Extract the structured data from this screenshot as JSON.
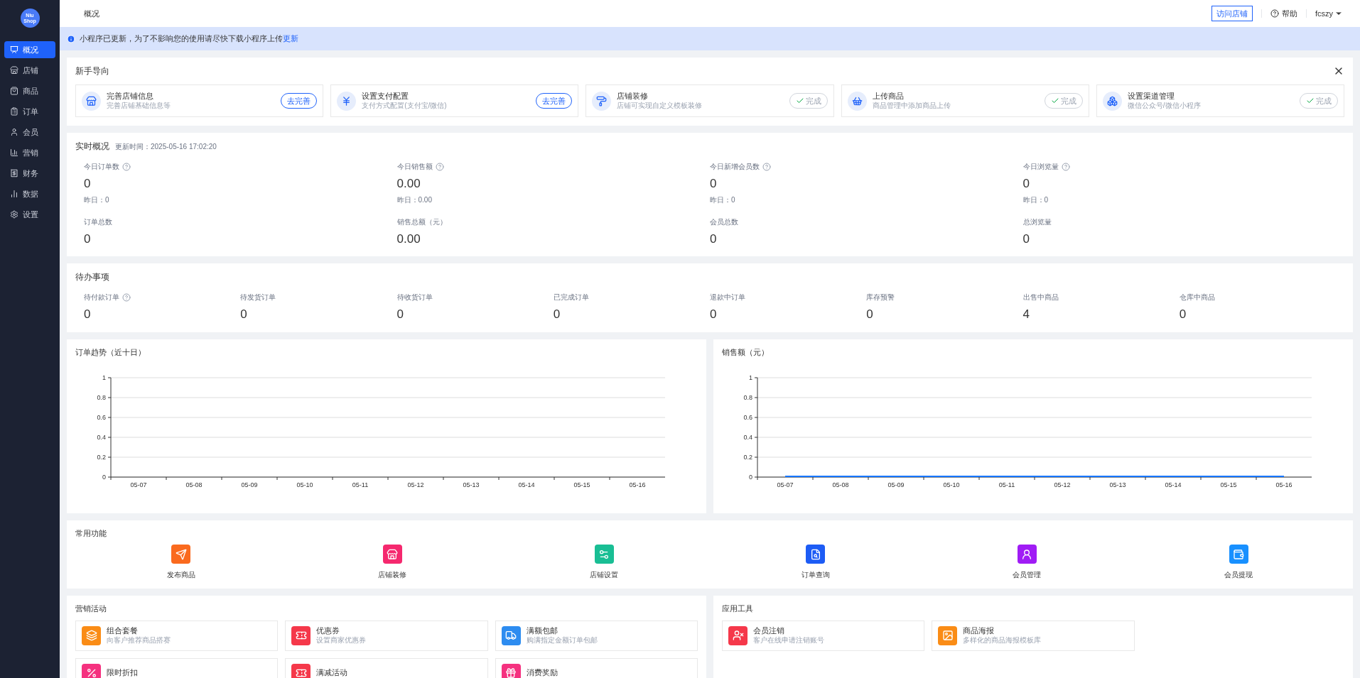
{
  "logo": {
    "line1": "Niu",
    "line2": "Shop"
  },
  "sidebar": {
    "items": [
      {
        "label": "概况",
        "selected": true
      },
      {
        "label": "店铺",
        "selected": false
      },
      {
        "label": "商品",
        "selected": false
      },
      {
        "label": "订单",
        "selected": false
      },
      {
        "label": "会员",
        "selected": false
      },
      {
        "label": "营销",
        "selected": false
      },
      {
        "label": "财务",
        "selected": false
      },
      {
        "label": "数据",
        "selected": false
      },
      {
        "label": "设置",
        "selected": false
      }
    ]
  },
  "header": {
    "breadcrumb": "概况",
    "visit_button": "访问店铺",
    "help": "帮助",
    "user": "fcszy"
  },
  "notice": {
    "text": "小程序已更新，为了不影响您的使用请尽快下载小程序上传",
    "link": "更新"
  },
  "guide": {
    "title": "新手导向",
    "items": [
      {
        "title": "完善店铺信息",
        "desc": "完善店铺基础信息等",
        "done": false,
        "button": "去完善"
      },
      {
        "title": "设置支付配置",
        "desc": "支付方式配置(支付宝/微信)",
        "done": false,
        "button": "去完善"
      },
      {
        "title": "店铺装修",
        "desc": "店铺可实现自定义模板装修",
        "done": true,
        "button": "完成"
      },
      {
        "title": "上传商品",
        "desc": "商品管理中添加商品上传",
        "done": true,
        "button": "完成"
      },
      {
        "title": "设置渠道管理",
        "desc": "微信公众号/微信小程序",
        "done": true,
        "button": "完成"
      }
    ]
  },
  "realtime": {
    "title": "实时概况",
    "updated": "更新时间：2025-05-16 17:02:20",
    "today": [
      {
        "label": "今日订单数",
        "value": "0",
        "yesterday": "昨日：0",
        "help": true
      },
      {
        "label": "今日销售额",
        "value": "0.00",
        "yesterday": "昨日：0.00",
        "help": true
      },
      {
        "label": "今日新增会员数",
        "value": "0",
        "yesterday": "昨日：0",
        "help": true
      },
      {
        "label": "今日浏览量",
        "value": "0",
        "yesterday": "昨日：0",
        "help": true
      }
    ],
    "totals": [
      {
        "label": "订单总数",
        "value": "0"
      },
      {
        "label": "销售总额（元）",
        "value": "0.00"
      },
      {
        "label": "会员总数",
        "value": "0"
      },
      {
        "label": "总浏览量",
        "value": "0"
      }
    ]
  },
  "todo": {
    "title": "待办事项",
    "items": [
      {
        "label": "待付款订单",
        "value": "0",
        "help": true
      },
      {
        "label": "待发货订单",
        "value": "0",
        "help": false
      },
      {
        "label": "待收货订单",
        "value": "0",
        "help": false
      },
      {
        "label": "已完成订单",
        "value": "0",
        "help": false
      },
      {
        "label": "退款中订单",
        "value": "0",
        "help": false
      },
      {
        "label": "库存预警",
        "value": "0",
        "help": false
      },
      {
        "label": "出售中商品",
        "value": "4",
        "help": false
      },
      {
        "label": "仓库中商品",
        "value": "0",
        "help": false
      }
    ]
  },
  "charts": [
    {
      "title": "订单趋势（近十日）",
      "chart_data": {
        "type": "bar",
        "grid": true,
        "categories": [
          "05-07",
          "05-08",
          "05-09",
          "05-10",
          "05-11",
          "05-12",
          "05-13",
          "05-14",
          "05-15",
          "05-16"
        ],
        "series": [
          {
            "color": "#1677ff",
            "values": [
              0,
              0,
              0,
              0,
              0,
              0,
              0,
              0,
              0,
              0
            ]
          }
        ],
        "ylim": [
          0,
          1
        ],
        "yticks": [
          0,
          0.2,
          0.4,
          0.6,
          0.8,
          1
        ]
      }
    },
    {
      "title": "销售额（元）",
      "chart_data": {
        "type": "line",
        "grid": true,
        "categories": [
          "05-07",
          "05-08",
          "05-09",
          "05-10",
          "05-11",
          "05-12",
          "05-13",
          "05-14",
          "05-15",
          "05-16"
        ],
        "series": [
          {
            "color": "#1677ff",
            "values": [
              0,
              0,
              0,
              0,
              0,
              0,
              0,
              0,
              0,
              0
            ]
          }
        ],
        "ylim": [
          0,
          1
        ],
        "yticks": [
          0,
          0.2,
          0.4,
          0.6,
          0.8,
          1
        ]
      }
    }
  ],
  "common": {
    "title": "常用功能",
    "items": [
      {
        "label": "发布商品",
        "color": "#fa6a1e"
      },
      {
        "label": "店铺装修",
        "color": "#f5286e"
      },
      {
        "label": "店铺设置",
        "color": "#19be94"
      },
      {
        "label": "订单查询",
        "color": "#1d5cf5"
      },
      {
        "label": "会员管理",
        "color": "#a01cf5"
      },
      {
        "label": "会员提现",
        "color": "#1890ff"
      }
    ]
  },
  "marketing": {
    "title": "营销活动",
    "items": [
      {
        "title": "组合套餐",
        "desc": "向客户推荐商品搭赛",
        "color": "#fa8c16"
      },
      {
        "title": "优惠券",
        "desc": "设置商家优惠券",
        "color": "#f5384a"
      },
      {
        "title": "满额包邮",
        "desc": "购满指定金额订单包邮",
        "color": "#2d8cf0"
      },
      {
        "title": "限时折扣",
        "color": "#f5317f"
      },
      {
        "title": "满减活动",
        "color": "#f5384a"
      },
      {
        "title": "消费奖励",
        "color": "#f5317f"
      }
    ]
  },
  "tools": {
    "title": "应用工具",
    "items": [
      {
        "title": "会员注销",
        "desc": "客户在线申请注销账号",
        "color": "#f5384a"
      },
      {
        "title": "商品海报",
        "desc": "多样化的商品海报模板库",
        "color": "#fa8c16"
      }
    ]
  }
}
